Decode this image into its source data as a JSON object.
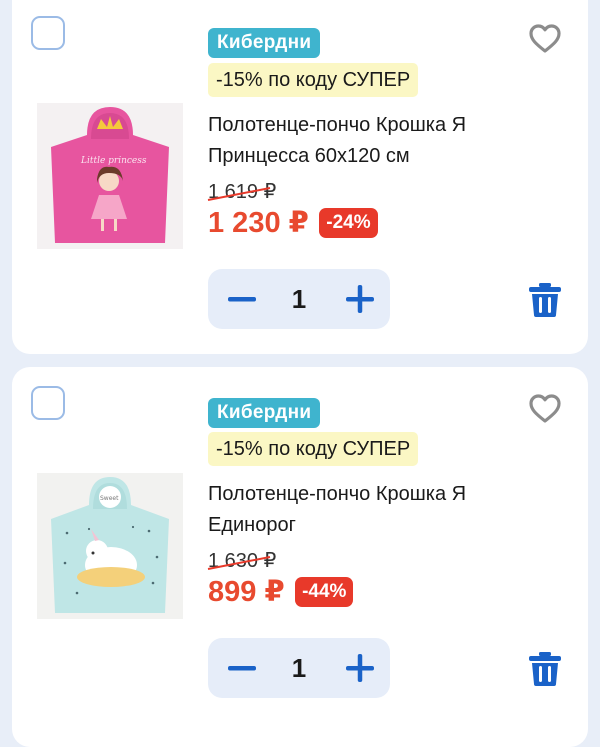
{
  "colors": {
    "accent": "#1a62c8",
    "price": "#e84a2f",
    "discount_badge": "#e8392a",
    "seller_badge": "#3fb4ce",
    "promo_bg": "#fbf7c4",
    "stepper_bg": "#e6edf9",
    "page_bg": "#e8eef8"
  },
  "cart": {
    "items": [
      {
        "seller": "Кибердни",
        "promo": "-15% по коду СУПЕР",
        "title": "Полотенце-пончо Крошка Я Принцесса 60х120 см",
        "old_price": "1 619 ₽",
        "price": "1 230 ₽",
        "discount": "-24%",
        "quantity": "1",
        "image_icon": "princess-poncho-photo",
        "checked": false
      },
      {
        "seller": "Кибердни",
        "promo": "-15% по коду СУПЕР",
        "title": "Полотенце-пончо Крошка Я Единорог",
        "old_price": "1 630 ₽",
        "price": "899 ₽",
        "discount": "-44%",
        "quantity": "1",
        "image_icon": "unicorn-poncho-photo",
        "checked": false
      }
    ],
    "icons": {
      "favorite": "heart-outline-icon",
      "decrease": "minus-icon",
      "increase": "plus-icon",
      "delete": "trash-icon",
      "select": "checkbox-icon"
    }
  }
}
